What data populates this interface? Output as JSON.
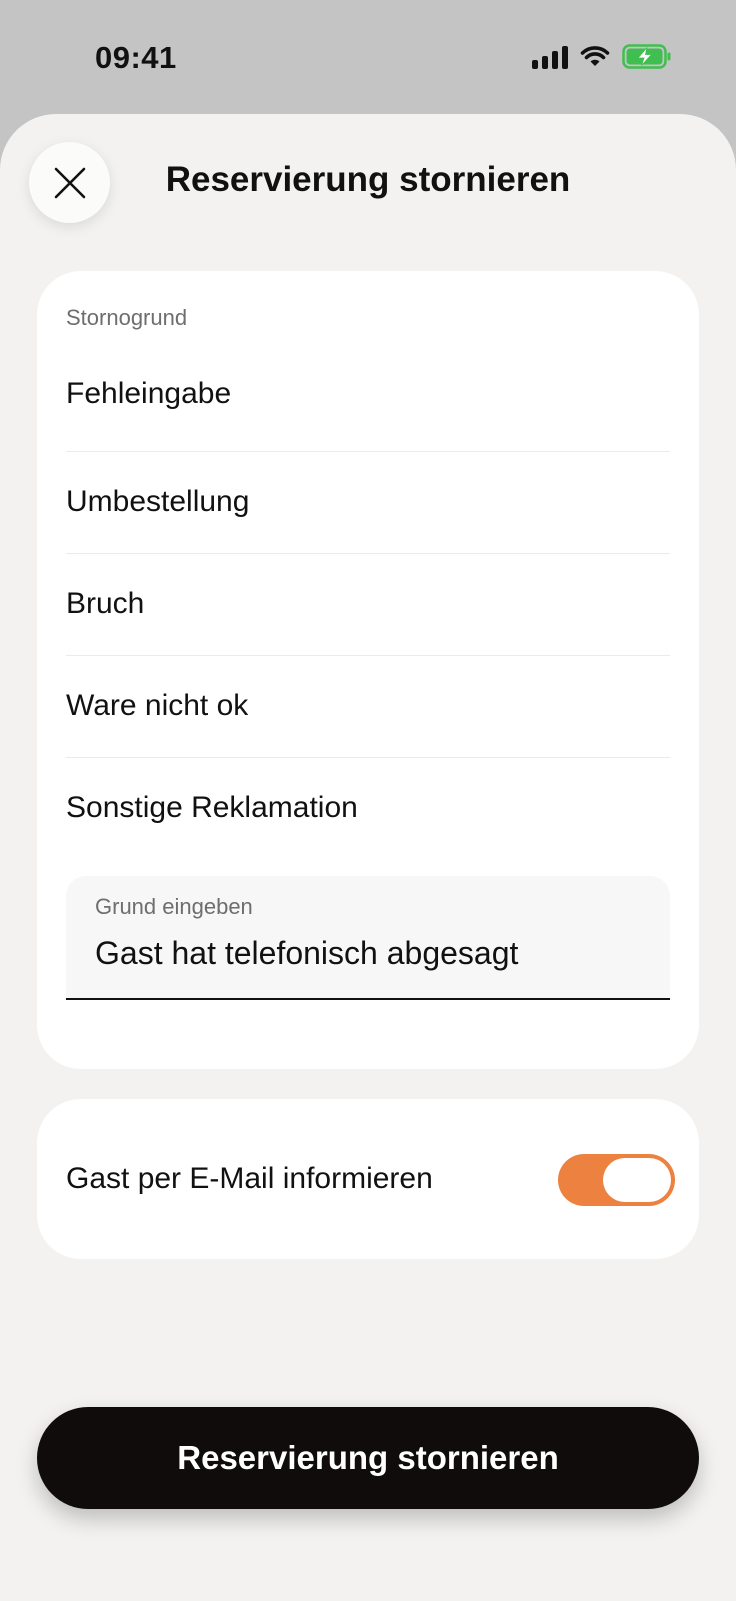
{
  "status_bar": {
    "time": "09:41",
    "icons": [
      "cellular-signal-icon",
      "wifi-icon",
      "battery-charging-icon"
    ],
    "battery_color": "#3fbf4f"
  },
  "header": {
    "title": "Reservierung stornieren",
    "close_icon": "close-icon"
  },
  "reasons": {
    "section_label": "Stornogrund",
    "items": [
      {
        "label": "Fehleingabe"
      },
      {
        "label": "Umbestellung"
      },
      {
        "label": "Bruch"
      },
      {
        "label": "Ware nicht ok"
      },
      {
        "label": "Sonstige Reklamation"
      }
    ],
    "custom_field": {
      "label": "Grund eingeben",
      "value": "Gast hat telefonisch abgesagt"
    }
  },
  "email_option": {
    "label": "Gast per E-Mail informieren",
    "enabled": true,
    "toggle_color": "#ed813f"
  },
  "primary_action": {
    "label": "Reservierung stornieren",
    "color": "#0f0c0b"
  }
}
